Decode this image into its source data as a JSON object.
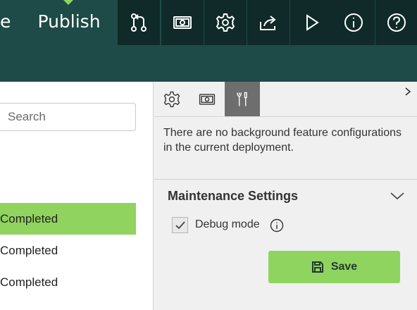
{
  "toolbar": {
    "left_fragment": "e",
    "active_tab": "Publish",
    "buttons": [
      {
        "icon": "merge-icon"
      },
      {
        "icon": "money-icon"
      },
      {
        "icon": "gear-icon"
      },
      {
        "icon": "share-icon"
      },
      {
        "icon": "play-icon"
      },
      {
        "icon": "info-icon"
      },
      {
        "icon": "help-icon"
      }
    ]
  },
  "left_pane": {
    "search_placeholder": "Search",
    "rows": [
      {
        "label": "Completed",
        "selected": true
      },
      {
        "label": "Completed",
        "selected": false
      },
      {
        "label": "Completed",
        "selected": false
      }
    ]
  },
  "panel": {
    "tabs": [
      {
        "icon": "gear-icon",
        "active": false
      },
      {
        "icon": "money-icon",
        "active": false
      },
      {
        "icon": "tools-icon",
        "active": true
      }
    ],
    "message": "There are no background feature configurations in the current deployment.",
    "section_title": "Maintenance Settings",
    "debug_label": "Debug mode",
    "debug_checked": true,
    "save_label": "Save"
  },
  "colors": {
    "toolbar_bg": "#1e4a47",
    "button_bg": "#0f2a28",
    "accent_green": "#8fd45f",
    "active_tab_bg": "#6e6e6e"
  }
}
